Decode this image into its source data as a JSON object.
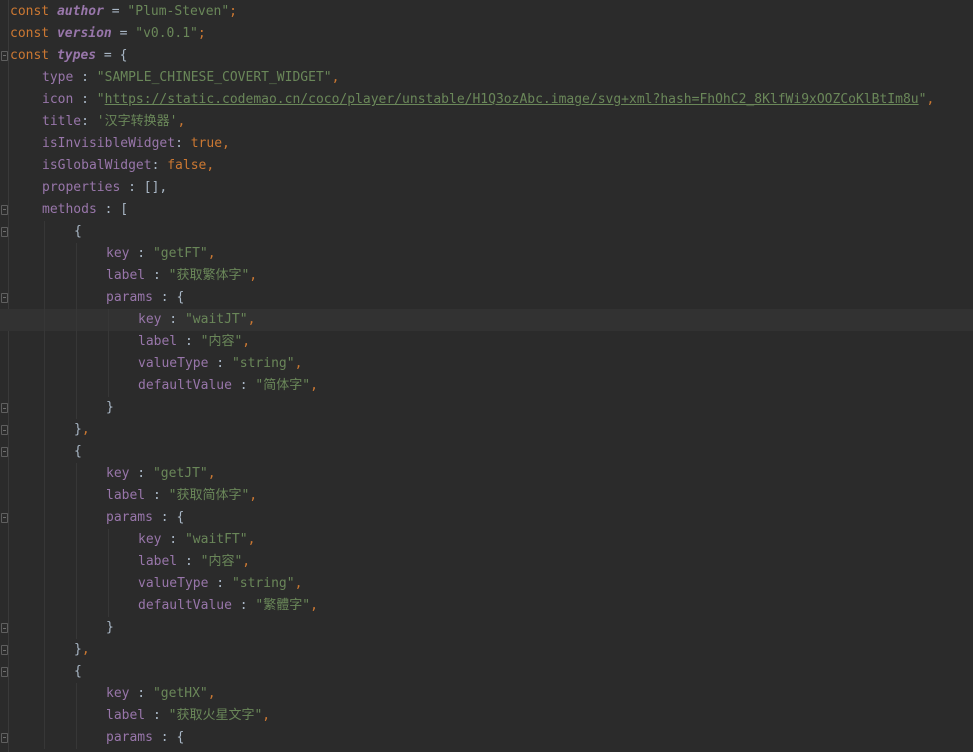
{
  "editor": {
    "lines": [
      {
        "indent": 0,
        "fold": "",
        "tokens": [
          {
            "t": "const",
            "c": "kw"
          },
          {
            "t": " ",
            "c": "op"
          },
          {
            "t": "author",
            "c": "id"
          },
          {
            "t": " = ",
            "c": "op"
          },
          {
            "t": "\"Plum-Steven\"",
            "c": "str"
          },
          {
            "t": ";",
            "c": "punc"
          }
        ]
      },
      {
        "indent": 0,
        "fold": "",
        "tokens": [
          {
            "t": "const",
            "c": "kw"
          },
          {
            "t": " ",
            "c": "op"
          },
          {
            "t": "version",
            "c": "id"
          },
          {
            "t": " = ",
            "c": "op"
          },
          {
            "t": "\"v0.0.1\"",
            "c": "str"
          },
          {
            "t": ";",
            "c": "punc"
          }
        ]
      },
      {
        "indent": 0,
        "fold": "open",
        "tokens": [
          {
            "t": "const",
            "c": "kw"
          },
          {
            "t": " ",
            "c": "op"
          },
          {
            "t": "types",
            "c": "id"
          },
          {
            "t": " = {",
            "c": "op"
          }
        ]
      },
      {
        "indent": 1,
        "fold": "",
        "tokens": [
          {
            "t": "type",
            "c": "prop"
          },
          {
            "t": " : ",
            "c": "op"
          },
          {
            "t": "\"SAMPLE_CHINESE_COVERT_WIDGET\"",
            "c": "str"
          },
          {
            "t": ",",
            "c": "punc"
          }
        ]
      },
      {
        "indent": 1,
        "fold": "",
        "tokens": [
          {
            "t": "icon",
            "c": "prop"
          },
          {
            "t": " : ",
            "c": "op"
          },
          {
            "t": "\"",
            "c": "str"
          },
          {
            "t": "https://static.codemao.cn/coco/player/unstable/H1Q3ozAbc.image/svg+xml?hash=FhOhC2_8KlfWi9xOOZCoKlBtIm8u",
            "c": "url"
          },
          {
            "t": "\"",
            "c": "str"
          },
          {
            "t": ",",
            "c": "punc"
          }
        ]
      },
      {
        "indent": 1,
        "fold": "",
        "tokens": [
          {
            "t": "title",
            "c": "prop"
          },
          {
            "t": ": ",
            "c": "op"
          },
          {
            "t": "'汉字转换器'",
            "c": "str"
          },
          {
            "t": ",",
            "c": "punc"
          }
        ]
      },
      {
        "indent": 1,
        "fold": "",
        "tokens": [
          {
            "t": "isInvisibleWidget",
            "c": "prop"
          },
          {
            "t": ": ",
            "c": "op"
          },
          {
            "t": "true",
            "c": "bool"
          },
          {
            "t": ",",
            "c": "punc"
          }
        ]
      },
      {
        "indent": 1,
        "fold": "",
        "tokens": [
          {
            "t": "isGlobalWidget",
            "c": "prop"
          },
          {
            "t": ": ",
            "c": "op"
          },
          {
            "t": "false",
            "c": "bool"
          },
          {
            "t": ",",
            "c": "punc"
          }
        ]
      },
      {
        "indent": 1,
        "fold": "",
        "tokens": [
          {
            "t": "properties",
            "c": "prop"
          },
          {
            "t": " : [],",
            "c": "op"
          }
        ]
      },
      {
        "indent": 1,
        "fold": "open",
        "tokens": [
          {
            "t": "methods",
            "c": "prop"
          },
          {
            "t": " : [",
            "c": "op"
          }
        ]
      },
      {
        "indent": 2,
        "fold": "open",
        "tokens": [
          {
            "t": "{",
            "c": "op"
          }
        ]
      },
      {
        "indent": 3,
        "fold": "",
        "tokens": [
          {
            "t": "key",
            "c": "prop"
          },
          {
            "t": " : ",
            "c": "op"
          },
          {
            "t": "\"getFT\"",
            "c": "str"
          },
          {
            "t": ",",
            "c": "punc"
          }
        ]
      },
      {
        "indent": 3,
        "fold": "",
        "tokens": [
          {
            "t": "label",
            "c": "prop"
          },
          {
            "t": " : ",
            "c": "op"
          },
          {
            "t": "\"获取繁体字\"",
            "c": "str"
          },
          {
            "t": ",",
            "c": "punc"
          }
        ]
      },
      {
        "indent": 3,
        "fold": "open",
        "tokens": [
          {
            "t": "params",
            "c": "prop"
          },
          {
            "t": " : {",
            "c": "op"
          }
        ]
      },
      {
        "indent": 4,
        "fold": "",
        "current": true,
        "tokens": [
          {
            "t": "key",
            "c": "prop"
          },
          {
            "t": " : ",
            "c": "op"
          },
          {
            "t": "\"waitJT\"",
            "c": "str"
          },
          {
            "t": ",",
            "c": "punc"
          }
        ]
      },
      {
        "indent": 4,
        "fold": "",
        "tokens": [
          {
            "t": "label",
            "c": "prop"
          },
          {
            "t": " : ",
            "c": "op"
          },
          {
            "t": "\"内容\"",
            "c": "str"
          },
          {
            "t": ",",
            "c": "punc"
          }
        ]
      },
      {
        "indent": 4,
        "fold": "",
        "tokens": [
          {
            "t": "valueType",
            "c": "prop"
          },
          {
            "t": " : ",
            "c": "op"
          },
          {
            "t": "\"string\"",
            "c": "str"
          },
          {
            "t": ",",
            "c": "punc"
          }
        ]
      },
      {
        "indent": 4,
        "fold": "",
        "tokens": [
          {
            "t": "defaultValue",
            "c": "prop"
          },
          {
            "t": " : ",
            "c": "op"
          },
          {
            "t": "\"简体字\"",
            "c": "str"
          },
          {
            "t": ",",
            "c": "punc"
          }
        ]
      },
      {
        "indent": 3,
        "fold": "close",
        "tokens": [
          {
            "t": "}",
            "c": "op"
          }
        ]
      },
      {
        "indent": 2,
        "fold": "close",
        "tokens": [
          {
            "t": "}",
            "c": "op"
          },
          {
            "t": ",",
            "c": "punc"
          }
        ]
      },
      {
        "indent": 2,
        "fold": "open",
        "tokens": [
          {
            "t": "{",
            "c": "op"
          }
        ]
      },
      {
        "indent": 3,
        "fold": "",
        "tokens": [
          {
            "t": "key",
            "c": "prop"
          },
          {
            "t": " : ",
            "c": "op"
          },
          {
            "t": "\"getJT\"",
            "c": "str"
          },
          {
            "t": ",",
            "c": "punc"
          }
        ]
      },
      {
        "indent": 3,
        "fold": "",
        "tokens": [
          {
            "t": "label",
            "c": "prop"
          },
          {
            "t": " : ",
            "c": "op"
          },
          {
            "t": "\"获取简体字\"",
            "c": "str"
          },
          {
            "t": ",",
            "c": "punc"
          }
        ]
      },
      {
        "indent": 3,
        "fold": "open",
        "tokens": [
          {
            "t": "params",
            "c": "prop"
          },
          {
            "t": " : {",
            "c": "op"
          }
        ]
      },
      {
        "indent": 4,
        "fold": "",
        "tokens": [
          {
            "t": "key",
            "c": "prop"
          },
          {
            "t": " : ",
            "c": "op"
          },
          {
            "t": "\"waitFT\"",
            "c": "str"
          },
          {
            "t": ",",
            "c": "punc"
          }
        ]
      },
      {
        "indent": 4,
        "fold": "",
        "tokens": [
          {
            "t": "label",
            "c": "prop"
          },
          {
            "t": " : ",
            "c": "op"
          },
          {
            "t": "\"内容\"",
            "c": "str"
          },
          {
            "t": ",",
            "c": "punc"
          }
        ]
      },
      {
        "indent": 4,
        "fold": "",
        "tokens": [
          {
            "t": "valueType",
            "c": "prop"
          },
          {
            "t": " : ",
            "c": "op"
          },
          {
            "t": "\"string\"",
            "c": "str"
          },
          {
            "t": ",",
            "c": "punc"
          }
        ]
      },
      {
        "indent": 4,
        "fold": "",
        "tokens": [
          {
            "t": "defaultValue",
            "c": "prop"
          },
          {
            "t": " : ",
            "c": "op"
          },
          {
            "t": "\"繁體字\"",
            "c": "str"
          },
          {
            "t": ",",
            "c": "punc"
          }
        ]
      },
      {
        "indent": 3,
        "fold": "close",
        "tokens": [
          {
            "t": "}",
            "c": "op"
          }
        ]
      },
      {
        "indent": 2,
        "fold": "close",
        "tokens": [
          {
            "t": "}",
            "c": "op"
          },
          {
            "t": ",",
            "c": "punc"
          }
        ]
      },
      {
        "indent": 2,
        "fold": "open",
        "tokens": [
          {
            "t": "{",
            "c": "op"
          }
        ]
      },
      {
        "indent": 3,
        "fold": "",
        "tokens": [
          {
            "t": "key",
            "c": "prop"
          },
          {
            "t": " : ",
            "c": "op"
          },
          {
            "t": "\"getHX\"",
            "c": "str"
          },
          {
            "t": ",",
            "c": "punc"
          }
        ]
      },
      {
        "indent": 3,
        "fold": "",
        "tokens": [
          {
            "t": "label",
            "c": "prop"
          },
          {
            "t": " : ",
            "c": "op"
          },
          {
            "t": "\"获取火星文字\"",
            "c": "str"
          },
          {
            "t": ",",
            "c": "punc"
          }
        ]
      },
      {
        "indent": 3,
        "fold": "open",
        "tokens": [
          {
            "t": "params",
            "c": "prop"
          },
          {
            "t": " : {",
            "c": "op"
          }
        ]
      }
    ]
  },
  "colors": {
    "background": "#2b2b2b",
    "current_line": "#323232",
    "keyword": "#cc7832",
    "identifier": "#9876aa",
    "string": "#6a8759",
    "text": "#a9b7c6"
  }
}
